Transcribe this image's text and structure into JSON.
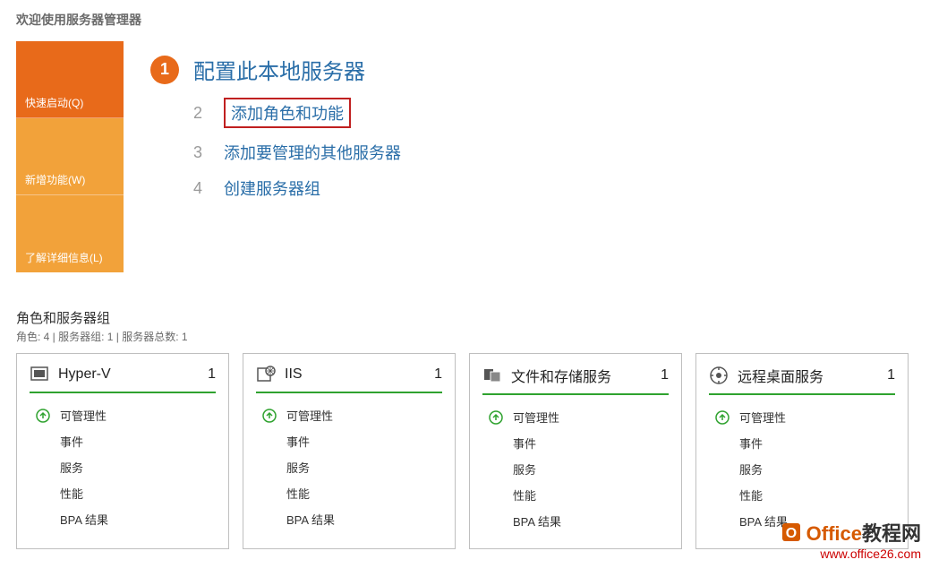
{
  "welcome_title": "欢迎使用服务器管理器",
  "sidebar": {
    "quick": "快速启动(Q)",
    "new": "新增功能(W)",
    "more": "了解详细信息(L)"
  },
  "quick": {
    "primary_num": "1",
    "primary_label": "配置此本地服务器",
    "items": [
      {
        "num": "2",
        "label": "添加角色和功能",
        "highlight": true
      },
      {
        "num": "3",
        "label": "添加要管理的其他服务器",
        "highlight": false
      },
      {
        "num": "4",
        "label": "创建服务器组",
        "highlight": false
      }
    ]
  },
  "roles": {
    "title": "角色和服务器组",
    "subtitle": "角色: 4 | 服务器组: 1 | 服务器总数: 1",
    "row_labels": {
      "manage": "可管理性",
      "events": "事件",
      "services": "服务",
      "perf": "性能",
      "bpa": "BPA 结果"
    },
    "cards": [
      {
        "name": "Hyper-V",
        "count": "1",
        "icon": "hyperv"
      },
      {
        "name": "IIS",
        "count": "1",
        "icon": "iis"
      },
      {
        "name": "文件和存储服务",
        "count": "1",
        "icon": "files"
      },
      {
        "name": "远程桌面服务",
        "count": "1",
        "icon": "remote"
      }
    ]
  },
  "watermark": {
    "brand_prefix": "Office",
    "brand_suffix": "教程网",
    "url": "www.office26.com"
  }
}
